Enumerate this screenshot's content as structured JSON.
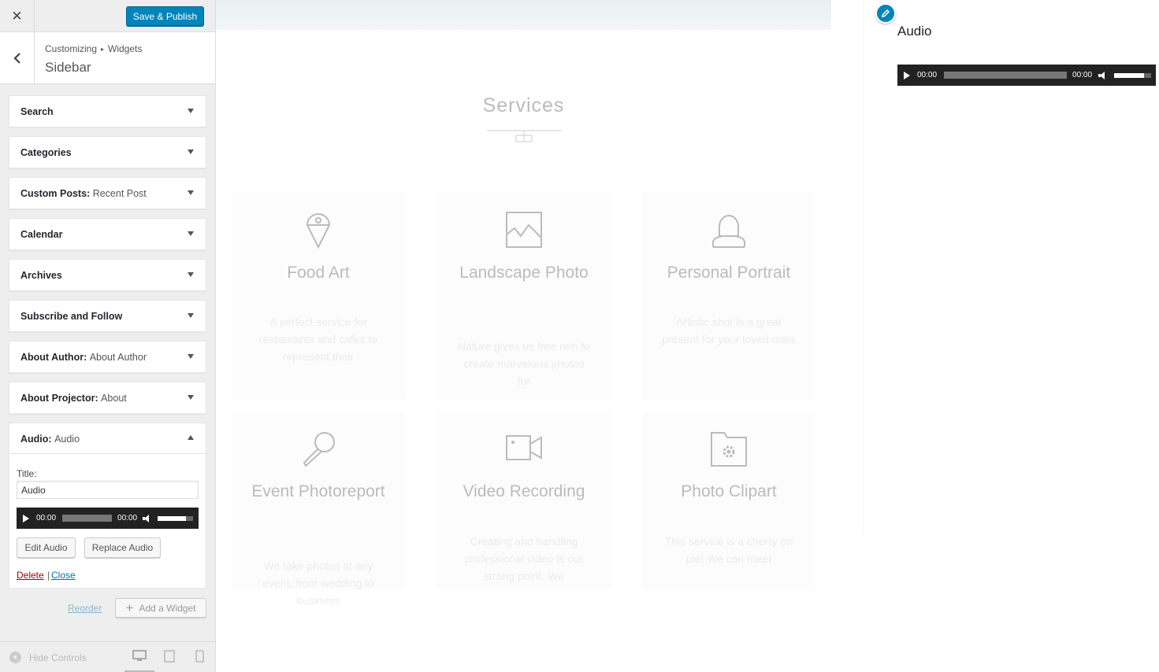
{
  "topbar": {
    "close_label": "✕",
    "publish_label": "Save & Publish"
  },
  "section": {
    "crumb_1": "Customizing",
    "crumb_sep": "▸",
    "crumb_2": "Widgets",
    "title": "Sidebar"
  },
  "widgets": [
    {
      "name": "Search",
      "sub": ""
    },
    {
      "name": "Categories",
      "sub": ""
    },
    {
      "name": "Custom Posts:",
      "sub": "Recent Post"
    },
    {
      "name": "Calendar",
      "sub": ""
    },
    {
      "name": "Archives",
      "sub": ""
    },
    {
      "name": "Subscribe and Follow",
      "sub": ""
    },
    {
      "name": "About Author:",
      "sub": "About Author"
    },
    {
      "name": "About Projector:",
      "sub": "About"
    }
  ],
  "audio_widget": {
    "name": "Audio:",
    "sub": "Audio",
    "title_label": "Title:",
    "title_value": "Audio",
    "time_current": "00:00",
    "time_total": "00:00",
    "edit_label": "Edit Audio",
    "replace_label": "Replace Audio",
    "delete_label": "Delete",
    "sep": "|",
    "close_label": "Close"
  },
  "panel_actions": {
    "reorder_label": "Reorder",
    "add_label": "Add a Widget"
  },
  "footer": {
    "hide_label": "Hide Controls"
  },
  "preview": {
    "services_title": "Services",
    "cards": [
      {
        "title": "Food Art",
        "desc": "A perfect service for restaurants and cafes to represent their",
        "icon": "ice-cream-icon"
      },
      {
        "title": "Landscape Photo",
        "desc": "Nature gives us free rein to create marvelous photos for",
        "icon": "landscape-image-icon"
      },
      {
        "title": "Personal Portrait",
        "desc": "Artistic shot is a great present for your loved ones",
        "icon": "portrait-icon"
      },
      {
        "title": "Event Photoreport",
        "desc": "We take photos at any event, from wedding to business",
        "icon": "microphone-icon"
      },
      {
        "title": "Video Recording",
        "desc": "Creating and handling professional video is our strong point. We",
        "icon": "video-camera-icon"
      },
      {
        "title": "Photo Clipart",
        "desc": "This service is a cherry on pie! We can meet",
        "icon": "folder-gear-icon"
      }
    ],
    "audio_heading": "Audio",
    "player_current": "00:00",
    "player_total": "00:00"
  },
  "colors": {
    "accent": "#0085ba",
    "link": "#0073aa",
    "delete": "#a00",
    "player_bg": "#222"
  }
}
